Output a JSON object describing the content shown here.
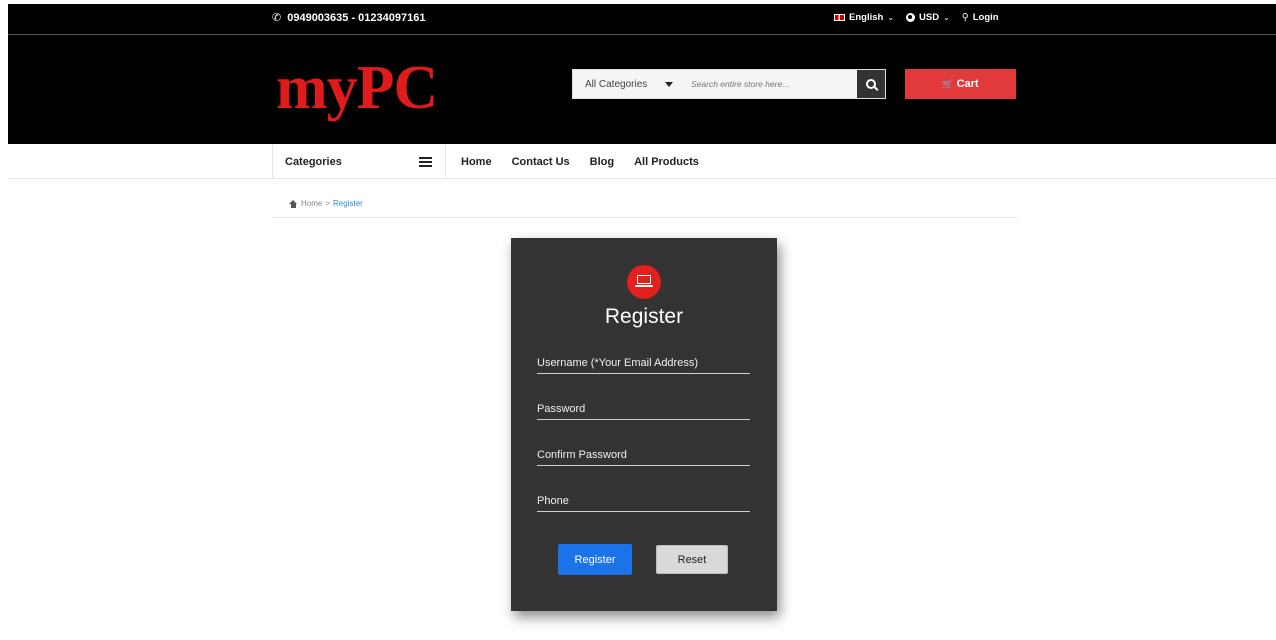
{
  "topbar": {
    "phone": "0949003635 - 01234097161",
    "language": "English",
    "currency": "USD",
    "login": "Login"
  },
  "header": {
    "logo": "myPC",
    "search": {
      "category": "All Categories",
      "placeholder": "Search entire store here..."
    },
    "cart_label": "Cart"
  },
  "nav": {
    "categories_label": "Categories",
    "links": [
      "Home",
      "Contact Us",
      "Blog",
      "All Products"
    ]
  },
  "breadcrumb": {
    "home": "Home",
    "separator": ">",
    "current": "Register"
  },
  "register": {
    "title": "Register",
    "fields": [
      {
        "placeholder": "Username (*Your Email Address)",
        "value": ""
      },
      {
        "placeholder": "Password",
        "value": ""
      },
      {
        "placeholder": "Confirm Password",
        "value": ""
      },
      {
        "placeholder": "Phone",
        "value": ""
      }
    ],
    "submit_label": "Register",
    "reset_label": "Reset"
  },
  "colors": {
    "brand_red": "#e01b1b",
    "cart_red": "#e23a3a",
    "primary_blue": "#1a73e8",
    "card_bg": "#333333"
  },
  "icons": [
    "phone-icon",
    "flag-icon",
    "globe-icon",
    "key-icon",
    "search-icon",
    "cart-icon",
    "menu-icon",
    "home-icon",
    "laptop-icon"
  ]
}
